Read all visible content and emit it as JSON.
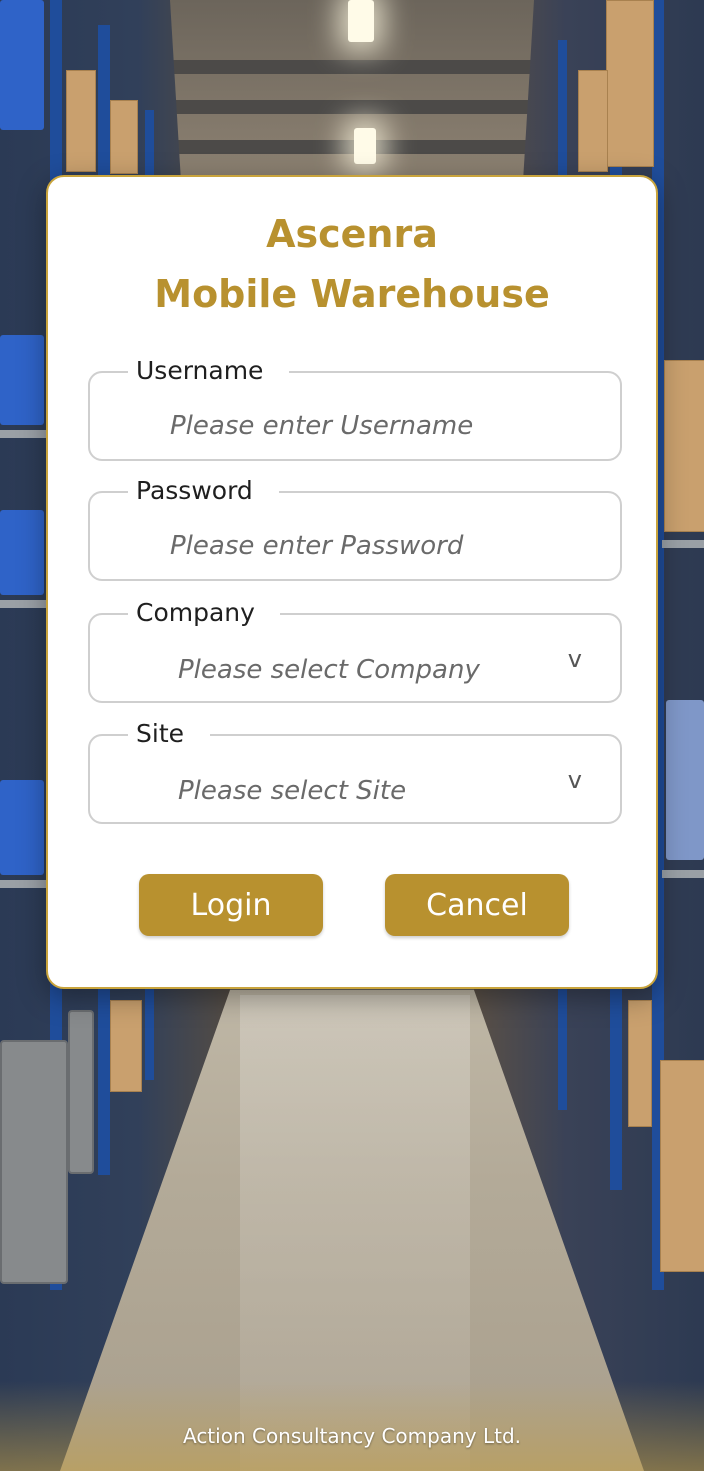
{
  "app": {
    "title_line1": "Ascenra",
    "title_line2": "Mobile Warehouse"
  },
  "form": {
    "username": {
      "label": "Username",
      "placeholder": "Please enter Username",
      "value": ""
    },
    "password": {
      "label": "Password",
      "placeholder": "Please enter Password",
      "value": ""
    },
    "company": {
      "label": "Company",
      "placeholder": "Please select Company",
      "chevron": "v"
    },
    "site": {
      "label": "Site",
      "placeholder": "Please select Site",
      "chevron": "v"
    }
  },
  "buttons": {
    "login": "Login",
    "cancel": "Cancel"
  },
  "footer": {
    "company": "Action Consultancy Company Ltd."
  },
  "colors": {
    "accent": "#b8912f",
    "card_border": "#c9a43c",
    "field_border": "#cfcfcf"
  }
}
